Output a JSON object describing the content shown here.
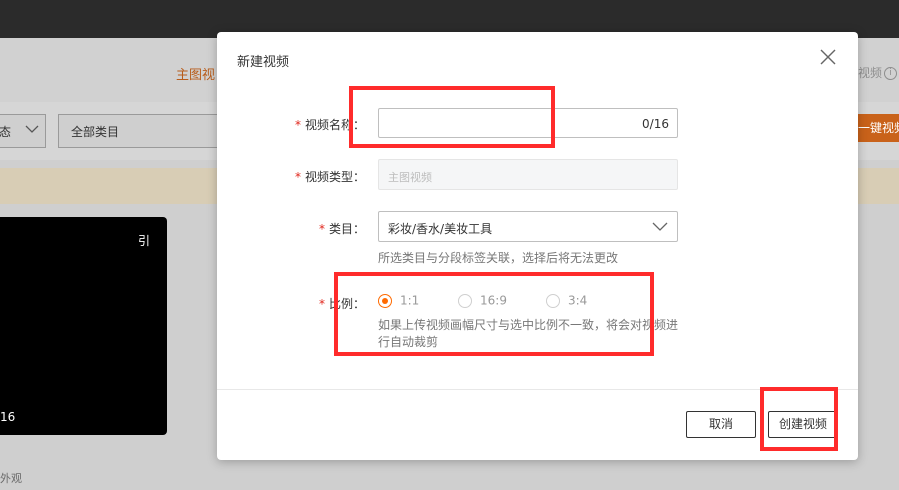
{
  "background": {
    "tab_label": "主图视",
    "right_tab_label": "视频",
    "info_icon": "ⓘ",
    "filter_status_label": "态",
    "filter_category_label": "全部类目",
    "one_click_btn_label": "一键视频",
    "video_card": {
      "tag": "引",
      "duration": "16",
      "caption": "外观"
    }
  },
  "modal": {
    "title": "新建视频",
    "close_icon": "close-icon",
    "fields": {
      "name": {
        "label": "视频名称：",
        "value": "",
        "counter": "0/16"
      },
      "type": {
        "label": "视频类型：",
        "value": "主图视频"
      },
      "category": {
        "label": "类目：",
        "value": "彩妆/香水/美妆工具",
        "hint": "所选类目与分段标签关联，选择后将无法更改"
      },
      "ratio": {
        "label": "比例：",
        "options": [
          {
            "label": "1:1",
            "checked": true
          },
          {
            "label": "16:9",
            "checked": false
          },
          {
            "label": "3:4",
            "checked": false
          }
        ],
        "hint_line1": "如果上传视频画幅尺寸与选中比例不一致，将会对视频进",
        "hint_line2": "行自动裁剪"
      }
    },
    "buttons": {
      "cancel": "取消",
      "create": "创建视频"
    }
  },
  "colors": {
    "accent": "#ff6a00",
    "required": "#e1251b",
    "highlight": "#ff2b2b"
  }
}
